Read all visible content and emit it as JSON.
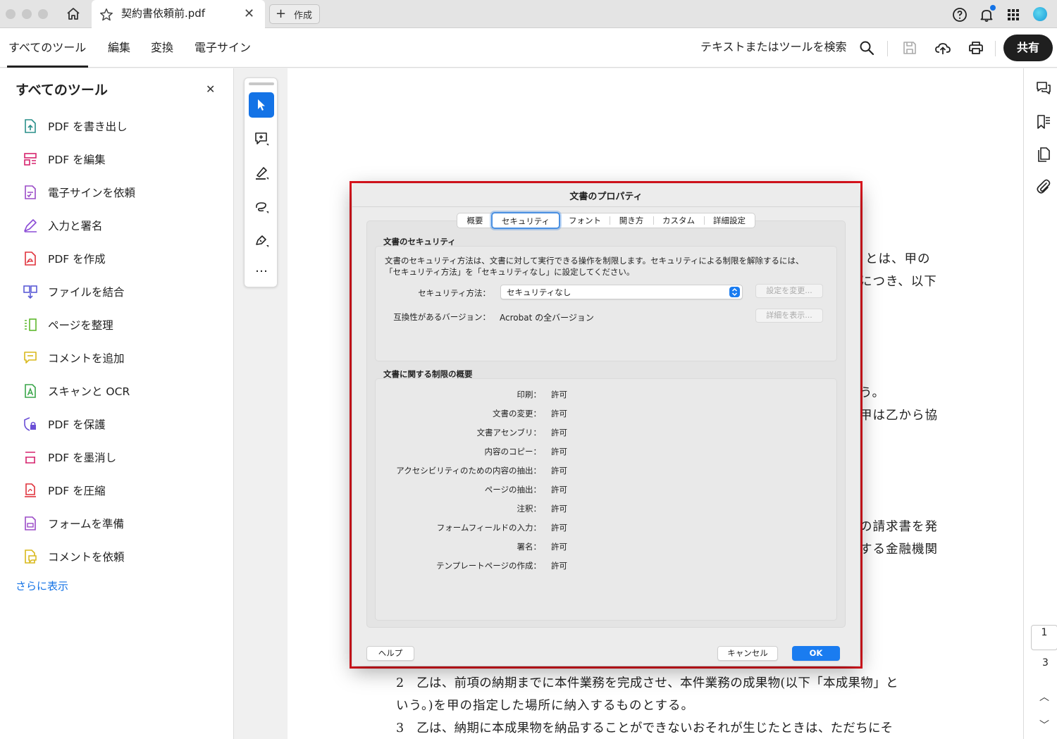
{
  "tabbar": {
    "document_title": "契約書依頼前.pdf",
    "close_glyph": "✕",
    "new_tab_label": "作成",
    "new_tab_glyph": "+"
  },
  "menubar": {
    "items": [
      "すべてのツール",
      "編集",
      "変換",
      "電子サイン"
    ],
    "search_label": "テキストまたはツールを検索",
    "share_label": "共有"
  },
  "left_panel": {
    "title": "すべてのツール",
    "close_glyph": "✕",
    "tools": [
      {
        "label": "PDF を書き出し",
        "icon": "export-pdf-icon",
        "color": "#2a8f8a"
      },
      {
        "label": "PDF を編集",
        "icon": "edit-pdf-icon",
        "color": "#d6246e"
      },
      {
        "label": "電子サインを依頼",
        "icon": "request-esign-icon",
        "color": "#9b4bc7"
      },
      {
        "label": "入力と署名",
        "icon": "fill-sign-icon",
        "color": "#8b4cd6"
      },
      {
        "label": "PDF を作成",
        "icon": "create-pdf-icon",
        "color": "#e0323c"
      },
      {
        "label": "ファイルを結合",
        "icon": "combine-files-icon",
        "color": "#5b5bd6"
      },
      {
        "label": "ページを整理",
        "icon": "organize-pages-icon",
        "color": "#5eb82d"
      },
      {
        "label": "コメントを追加",
        "icon": "add-comment-icon",
        "color": "#d8b81c"
      },
      {
        "label": "スキャンと OCR",
        "icon": "scan-ocr-icon",
        "color": "#3aa64a"
      },
      {
        "label": "PDF を保護",
        "icon": "protect-pdf-icon",
        "color": "#6b4fd6"
      },
      {
        "label": "PDF を墨消し",
        "icon": "redact-pdf-icon",
        "color": "#d6246e"
      },
      {
        "label": "PDF を圧縮",
        "icon": "compress-pdf-icon",
        "color": "#e0323c"
      },
      {
        "label": "フォームを準備",
        "icon": "prepare-form-icon",
        "color": "#9b4bc7"
      },
      {
        "label": "コメントを依頼",
        "icon": "request-comment-icon",
        "color": "#d8b81c"
      }
    ],
    "show_more": "さらに表示"
  },
  "float_tools": {
    "more_glyph": "…"
  },
  "page_text": {
    "r1": "とは、甲の",
    "r2": "につき、以下",
    "r3": "う。",
    "r4": "甲は乙から協",
    "r5": "の請求書を発",
    "r6": "する金融機関",
    "b1": "2　乙は、前項の納期までに本件業務を完成させ、本件業務の成果物(以下「本成果物」と",
    "b2": "いう。)を甲の指定した場所に納入するものとする。",
    "b3": "3　乙は、納期に本成果物を納品することができないおそれが生じたときは、ただちにそ"
  },
  "right_rail": {
    "current_page": "1",
    "total_pages": "3",
    "up_glyph": "︿",
    "down_glyph": "﹀"
  },
  "dialog": {
    "title": "文書のプロパティ",
    "tabs": [
      "概要",
      "セキュリティ",
      "フォント",
      "開き方",
      "カスタム",
      "詳細設定"
    ],
    "active_tab": "セキュリティ",
    "security_section": {
      "heading": "文書のセキュリティ",
      "description_1": "文書のセキュリティ方法は、文書に対して実行できる操作を制限します。セキュリティによる制限を解除するには、",
      "description_2": "「セキュリティ方法」を「セキュリティなし」に設定してください。",
      "method_label": "セキュリティ方法：",
      "method_value": "セキュリティなし",
      "change_settings_button": "設定を変更...",
      "compat_label": "互換性があるバージョン：",
      "compat_value": "Acrobat の全バージョン",
      "show_details_button": "詳細を表示..."
    },
    "restrictions_section": {
      "heading": "文書に関する制限の概要",
      "rows": [
        {
          "label": "印刷：",
          "value": "許可"
        },
        {
          "label": "文書の変更：",
          "value": "許可"
        },
        {
          "label": "文書アセンブリ：",
          "value": "許可"
        },
        {
          "label": "内容のコピー：",
          "value": "許可"
        },
        {
          "label": "アクセシビリティのための内容の抽出：",
          "value": "許可"
        },
        {
          "label": "ページの抽出：",
          "value": "許可"
        },
        {
          "label": "注釈：",
          "value": "許可"
        },
        {
          "label": "フォームフィールドの入力：",
          "value": "許可"
        },
        {
          "label": "署名：",
          "value": "許可"
        },
        {
          "label": "テンプレートページの作成：",
          "value": "許可"
        }
      ]
    },
    "help_button": "ヘルプ",
    "cancel_button": "キャンセル",
    "ok_button": "OK"
  },
  "colors": {
    "accent": "#1473e6",
    "highlight": "#e0141e",
    "dialog_primary": "#1a7cf0"
  }
}
